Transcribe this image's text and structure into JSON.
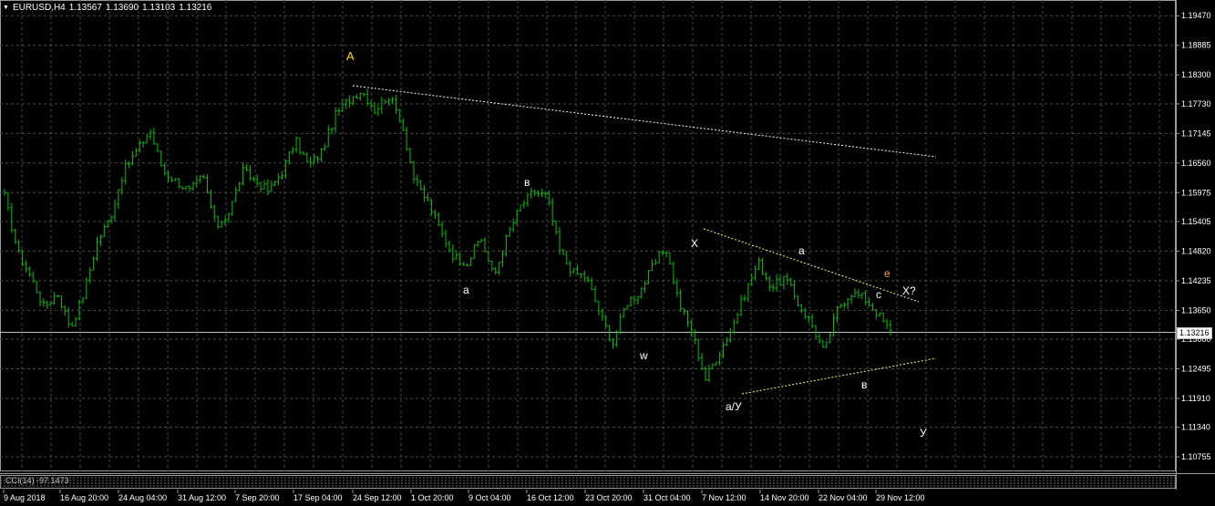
{
  "symbol": {
    "name": "EURUSD,H4",
    "open": "1.13567",
    "high": "1.13690",
    "low": "1.13103",
    "close": "1.13216"
  },
  "indicator": {
    "label": "CCI(14) -97.1473"
  },
  "current_price": "1.13216",
  "price_axis": [
    "1.19470",
    "1.18885",
    "1.18300",
    "1.17730",
    "1.17145",
    "1.16560",
    "1.15975",
    "1.15405",
    "1.14820",
    "1.14235",
    "1.13650",
    "1.13080",
    "1.12495",
    "1.11910",
    "1.11340",
    "1.10755"
  ],
  "time_axis": [
    "9 Aug 2018",
    "16 Aug 20:00",
    "24 Aug 04:00",
    "31 Aug 12:00",
    "7 Sep 20:00",
    "17 Sep 04:00",
    "24 Sep 12:00",
    "1 Oct 20:00",
    "9 Oct 04:00",
    "16 Oct 12:00",
    "23 Oct 20:00",
    "31 Oct 04:00",
    "7 Nov 12:00",
    "14 Nov 20:00",
    "22 Nov 04:00",
    "29 Nov 12:00"
  ],
  "wave_labels": [
    {
      "text": "A",
      "color": "#ffd700"
    },
    {
      "text": "в",
      "color": "#ffffff"
    },
    {
      "text": "a",
      "color": "#ffffff"
    },
    {
      "text": "X",
      "color": "#ffffff"
    },
    {
      "text": "a",
      "color": "#ffffff"
    },
    {
      "text": "w",
      "color": "#ffffff"
    },
    {
      "text": "e",
      "color": "#ffa500"
    },
    {
      "text": "c",
      "color": "#ffffff"
    },
    {
      "text": "X?",
      "color": "#ffffff"
    },
    {
      "text": "a/У",
      "color": "#ffffff"
    },
    {
      "text": "в",
      "color": "#ffffff"
    },
    {
      "text": "У",
      "color": "#ffffff"
    }
  ],
  "colors": {
    "background": "#000000",
    "grid": "#4a4a4a",
    "candle": "#00c000",
    "price_line": "#c0c0c0",
    "trendline": "#ffffe0",
    "triangle_line": "#ffff66",
    "axis_text": "#ffffff"
  },
  "chart_data": {
    "type": "line",
    "series": [
      {
        "values": [
          1.159,
          1.148,
          1.143,
          1.137,
          1.14,
          1.133,
          1.14,
          1.15,
          1.155,
          1.164,
          1.168,
          1.172,
          1.164,
          1.162,
          1.16,
          1.163,
          1.153,
          1.156,
          1.164,
          1.162,
          1.16,
          1.164,
          1.17,
          1.165,
          1.168,
          1.175,
          1.178,
          1.18,
          1.176,
          1.179,
          1.174,
          1.162,
          1.158,
          1.152,
          1.147,
          1.146,
          1.151,
          1.143,
          1.151,
          1.157,
          1.16,
          1.159,
          1.148,
          1.144,
          1.143,
          1.136,
          1.13,
          1.138,
          1.14,
          1.145,
          1.149,
          1.138,
          1.132,
          1.123,
          1.128,
          1.133,
          1.14,
          1.146,
          1.141,
          1.143,
          1.138,
          1.134,
          1.128,
          1.137,
          1.14,
          1.139,
          1.136,
          1.1322
        ]
      }
    ],
    "ylim": [
      1.1047,
      1.1978
    ],
    "grid": true,
    "legend": "none"
  }
}
